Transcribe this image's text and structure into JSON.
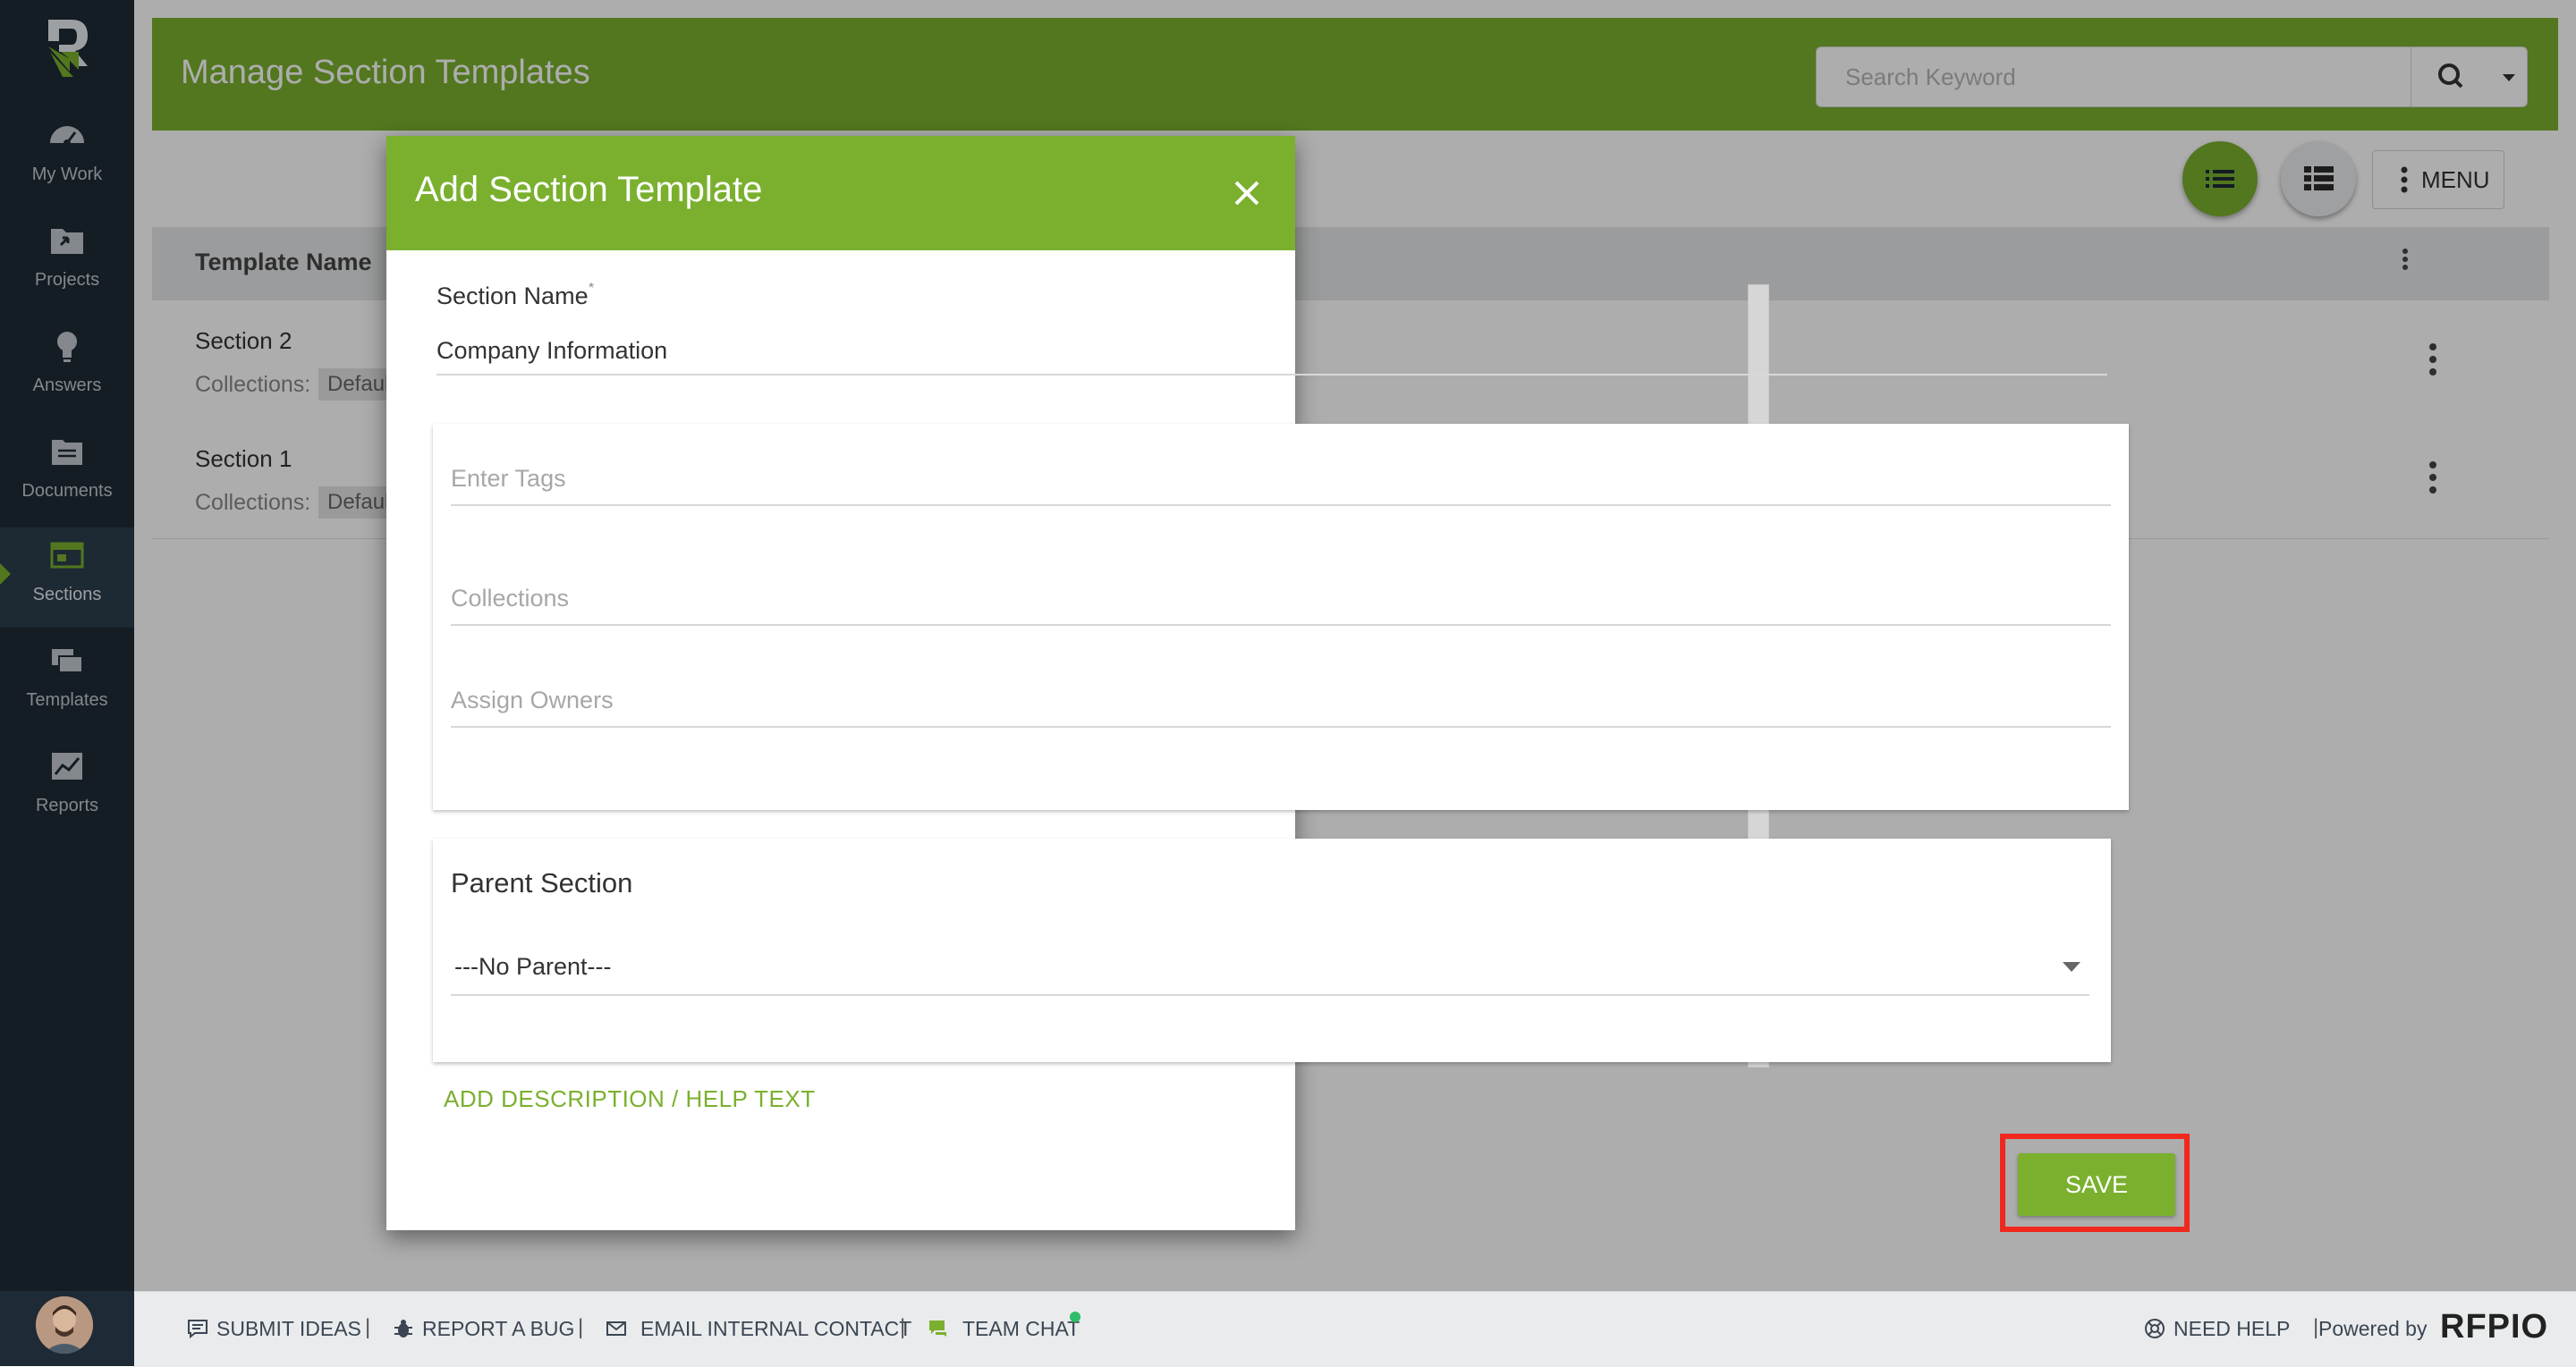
{
  "app": {
    "brand": "RFPIO",
    "powered_by": "Powered by"
  },
  "sidebar": {
    "items": [
      {
        "label": "My Work",
        "icon": "dashboard-icon"
      },
      {
        "label": "Projects",
        "icon": "folder-icon"
      },
      {
        "label": "Answers",
        "icon": "lightbulb-icon"
      },
      {
        "label": "Documents",
        "icon": "documents-icon"
      },
      {
        "label": "Sections",
        "icon": "sections-icon",
        "active": true
      },
      {
        "label": "Templates",
        "icon": "templates-icon"
      },
      {
        "label": "Reports",
        "icon": "reports-icon"
      }
    ]
  },
  "header": {
    "title": "Manage Section Templates",
    "search_placeholder": "Search Keyword",
    "menu_label": "MENU"
  },
  "table": {
    "column_template_name": "Template Name",
    "rows": [
      {
        "name": "Section 2",
        "collections_label": "Collections:",
        "collection": "Default"
      },
      {
        "name": "Section 1",
        "collections_label": "Collections:",
        "collection": "Default"
      }
    ]
  },
  "modal": {
    "title": "Add Section Template",
    "section_name_label": "Section Name",
    "required_mark": "*",
    "section_name_value": "Company Information",
    "tags_placeholder": "Enter Tags",
    "collections_placeholder": "Collections",
    "owners_placeholder": "Assign Owners",
    "parent_section_title": "Parent Section",
    "parent_section_value": "---No Parent---",
    "add_description_link": "ADD DESCRIPTION / HELP TEXT",
    "save_label": "SAVE"
  },
  "footer": {
    "submit_ideas": "SUBMIT IDEAS",
    "report_bug": "REPORT A BUG",
    "email_contact": "EMAIL INTERNAL CONTACT",
    "team_chat": "TEAM CHAT",
    "need_help": "NEED HELP",
    "separator": "|"
  },
  "colors": {
    "accent": "#7ab02e",
    "sidebar": "#1e2a35",
    "highlight": "#f0281e"
  }
}
